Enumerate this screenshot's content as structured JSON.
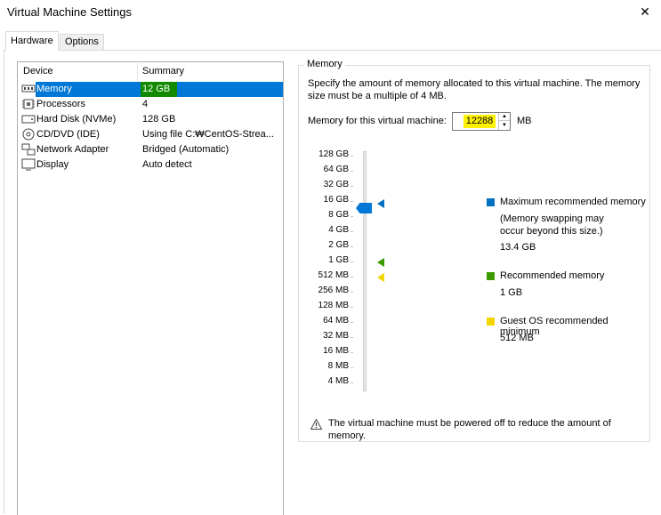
{
  "window": {
    "title": "Virtual Machine Settings"
  },
  "tabs": [
    {
      "label": "Hardware",
      "active": true
    },
    {
      "label": "Options",
      "active": false
    }
  ],
  "devices": {
    "headers": {
      "device": "Device",
      "summary": "Summary"
    },
    "items": [
      {
        "name": "Memory",
        "summary": "12 GB",
        "icon": "memory-icon",
        "selected": true
      },
      {
        "name": "Processors",
        "summary": "4",
        "icon": "processor-icon"
      },
      {
        "name": "Hard Disk (NVMe)",
        "summary": "128 GB",
        "icon": "hard-disk-icon"
      },
      {
        "name": "CD/DVD (IDE)",
        "summary": "Using file C:₩CentOS-Strea...",
        "icon": "cd-dvd-icon"
      },
      {
        "name": "Network Adapter",
        "summary": "Bridged (Automatic)",
        "icon": "network-adapter-icon"
      },
      {
        "name": "Display",
        "summary": "Auto detect",
        "icon": "display-icon"
      }
    ]
  },
  "memory": {
    "group_label": "Memory",
    "description": "Specify the amount of memory allocated to this virtual machine. The memory size must be a multiple of 4 MB.",
    "field_label": "Memory for this virtual machine:",
    "value": "12288",
    "unit": "MB",
    "scale_labels": [
      "128 GB",
      "64 GB",
      "32 GB",
      "16 GB",
      "8 GB",
      "4 GB",
      "2 GB",
      "1 GB",
      "512 MB",
      "256 MB",
      "128 MB",
      "64 MB",
      "32 MB",
      "16 MB",
      "8 MB",
      "4 MB"
    ],
    "legend": {
      "max_title": "Maximum recommended memory",
      "max_note": "(Memory swapping may occur beyond this size.)",
      "max_value": "13.4 GB",
      "rec_title": "Recommended memory",
      "rec_value": "1 GB",
      "guest_title": "Guest OS recommended minimum",
      "guest_value": "512 MB"
    },
    "warning": "The virtual machine must be powered off to reduce the amount of memory."
  },
  "colors": {
    "selection": "#0078d7",
    "max": "#0070c0",
    "rec": "#3c9a00",
    "guest": "#f2d600",
    "highlight": "#fff200"
  }
}
